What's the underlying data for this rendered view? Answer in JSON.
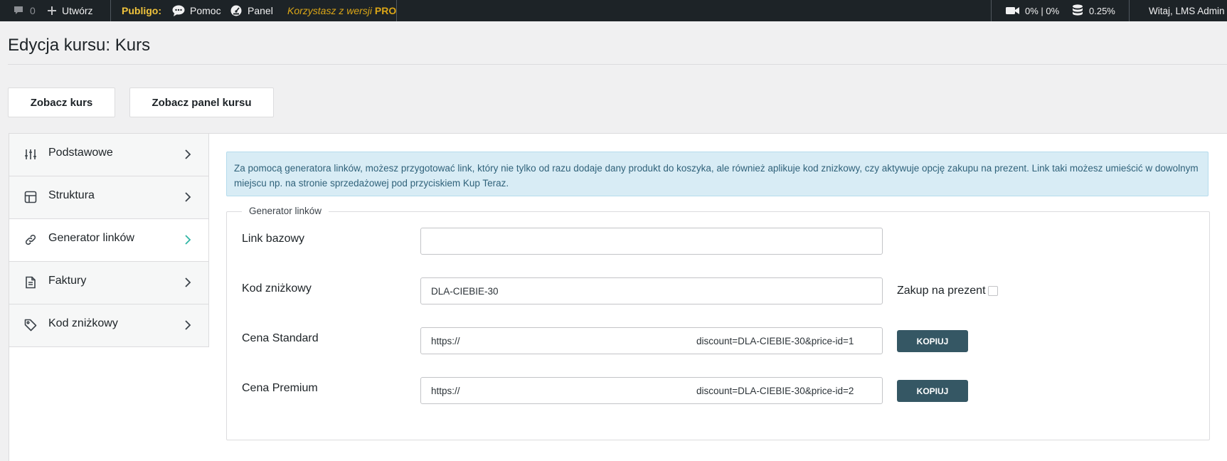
{
  "adminbar": {
    "comments_count": "0",
    "create_label": "Utwórz",
    "publigo_label": "Publigo:",
    "help_label": "Pomoc",
    "panel_label": "Panel",
    "pro_prefix": "Korzystasz z wersji",
    "pro_suffix": "PRO",
    "video_usage": "0% | 0%",
    "disk_usage": "0.25%",
    "greeting": "Witaj, LMS Admin"
  },
  "page": {
    "title": "Edycja kursu: Kurs"
  },
  "buttons": {
    "view_course": "Zobacz kurs",
    "view_course_panel": "Zobacz panel kursu"
  },
  "sidebar": {
    "items": [
      {
        "label": "Podstawowe",
        "icon": "sliders-icon"
      },
      {
        "label": "Struktura",
        "icon": "grid-icon"
      },
      {
        "label": "Generator linków",
        "icon": "link-icon",
        "active": true
      },
      {
        "label": "Faktury",
        "icon": "document-icon"
      },
      {
        "label": "Kod zniżkowy",
        "icon": "tag-icon"
      }
    ]
  },
  "notice": {
    "text": "Za pomocą generatora linków, możesz przygotować link, który nie tylko od razu dodaje dany produkt do koszyka, ale również aplikuje kod znizkowy, czy aktywuje opcję zakupu na prezent. Link taki możesz umieścić w dowolnym miejscu np. na stronie sprzedażowej pod przyciskiem Kup Teraz."
  },
  "generator": {
    "legend": "Generator linków",
    "base_link_label": "Link bazowy",
    "base_link_value": "",
    "discount_label": "Kod zniżkowy",
    "discount_value": "DLA-CIEBIE-30",
    "gift_label": "Zakup na prezent",
    "gift_checked": false,
    "rows": [
      {
        "label": "Cena Standard",
        "url_start": "https://",
        "url_end": "discount=DLA-CIEBIE-30&price-id=1",
        "button": "KOPIUJ"
      },
      {
        "label": "Cena Premium",
        "url_start": "https://",
        "url_end": "discount=DLA-CIEBIE-30&price-id=2",
        "button": "KOPIUJ"
      }
    ]
  },
  "colors": {
    "adminbar_bg": "#1d2327",
    "accent_teal": "#2fb5a5",
    "copy_button": "#355764",
    "notice_bg": "#d8ecf5"
  }
}
